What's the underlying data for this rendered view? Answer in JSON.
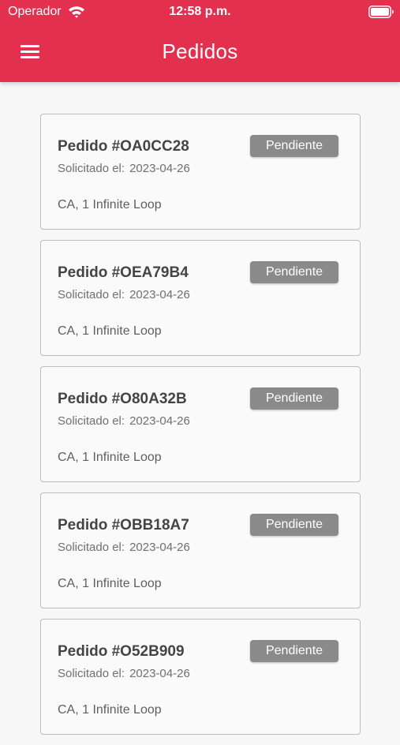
{
  "status_bar": {
    "carrier": "Operador",
    "time": "12:58 p.m."
  },
  "app_bar": {
    "title": "Pedidos",
    "accent_color": "#e4304f"
  },
  "orders": [
    {
      "title": "Pedido #OA0CC28",
      "date_label": "Solicitado el:",
      "date": "2023-04-26",
      "address": "CA, 1 Infinite Loop",
      "status": "Pendiente"
    },
    {
      "title": "Pedido #OEA79B4",
      "date_label": "Solicitado el:",
      "date": "2023-04-26",
      "address": "CA, 1 Infinite Loop",
      "status": "Pendiente"
    },
    {
      "title": "Pedido #O80A32B",
      "date_label": "Solicitado el:",
      "date": "2023-04-26",
      "address": "CA, 1 Infinite Loop",
      "status": "Pendiente"
    },
    {
      "title": "Pedido #OBB18A7",
      "date_label": "Solicitado el:",
      "date": "2023-04-26",
      "address": "CA, 1 Infinite Loop",
      "status": "Pendiente"
    },
    {
      "title": "Pedido #O52B909",
      "date_label": "Solicitado el:",
      "date": "2023-04-26",
      "address": "CA, 1 Infinite Loop",
      "status": "Pendiente"
    }
  ]
}
